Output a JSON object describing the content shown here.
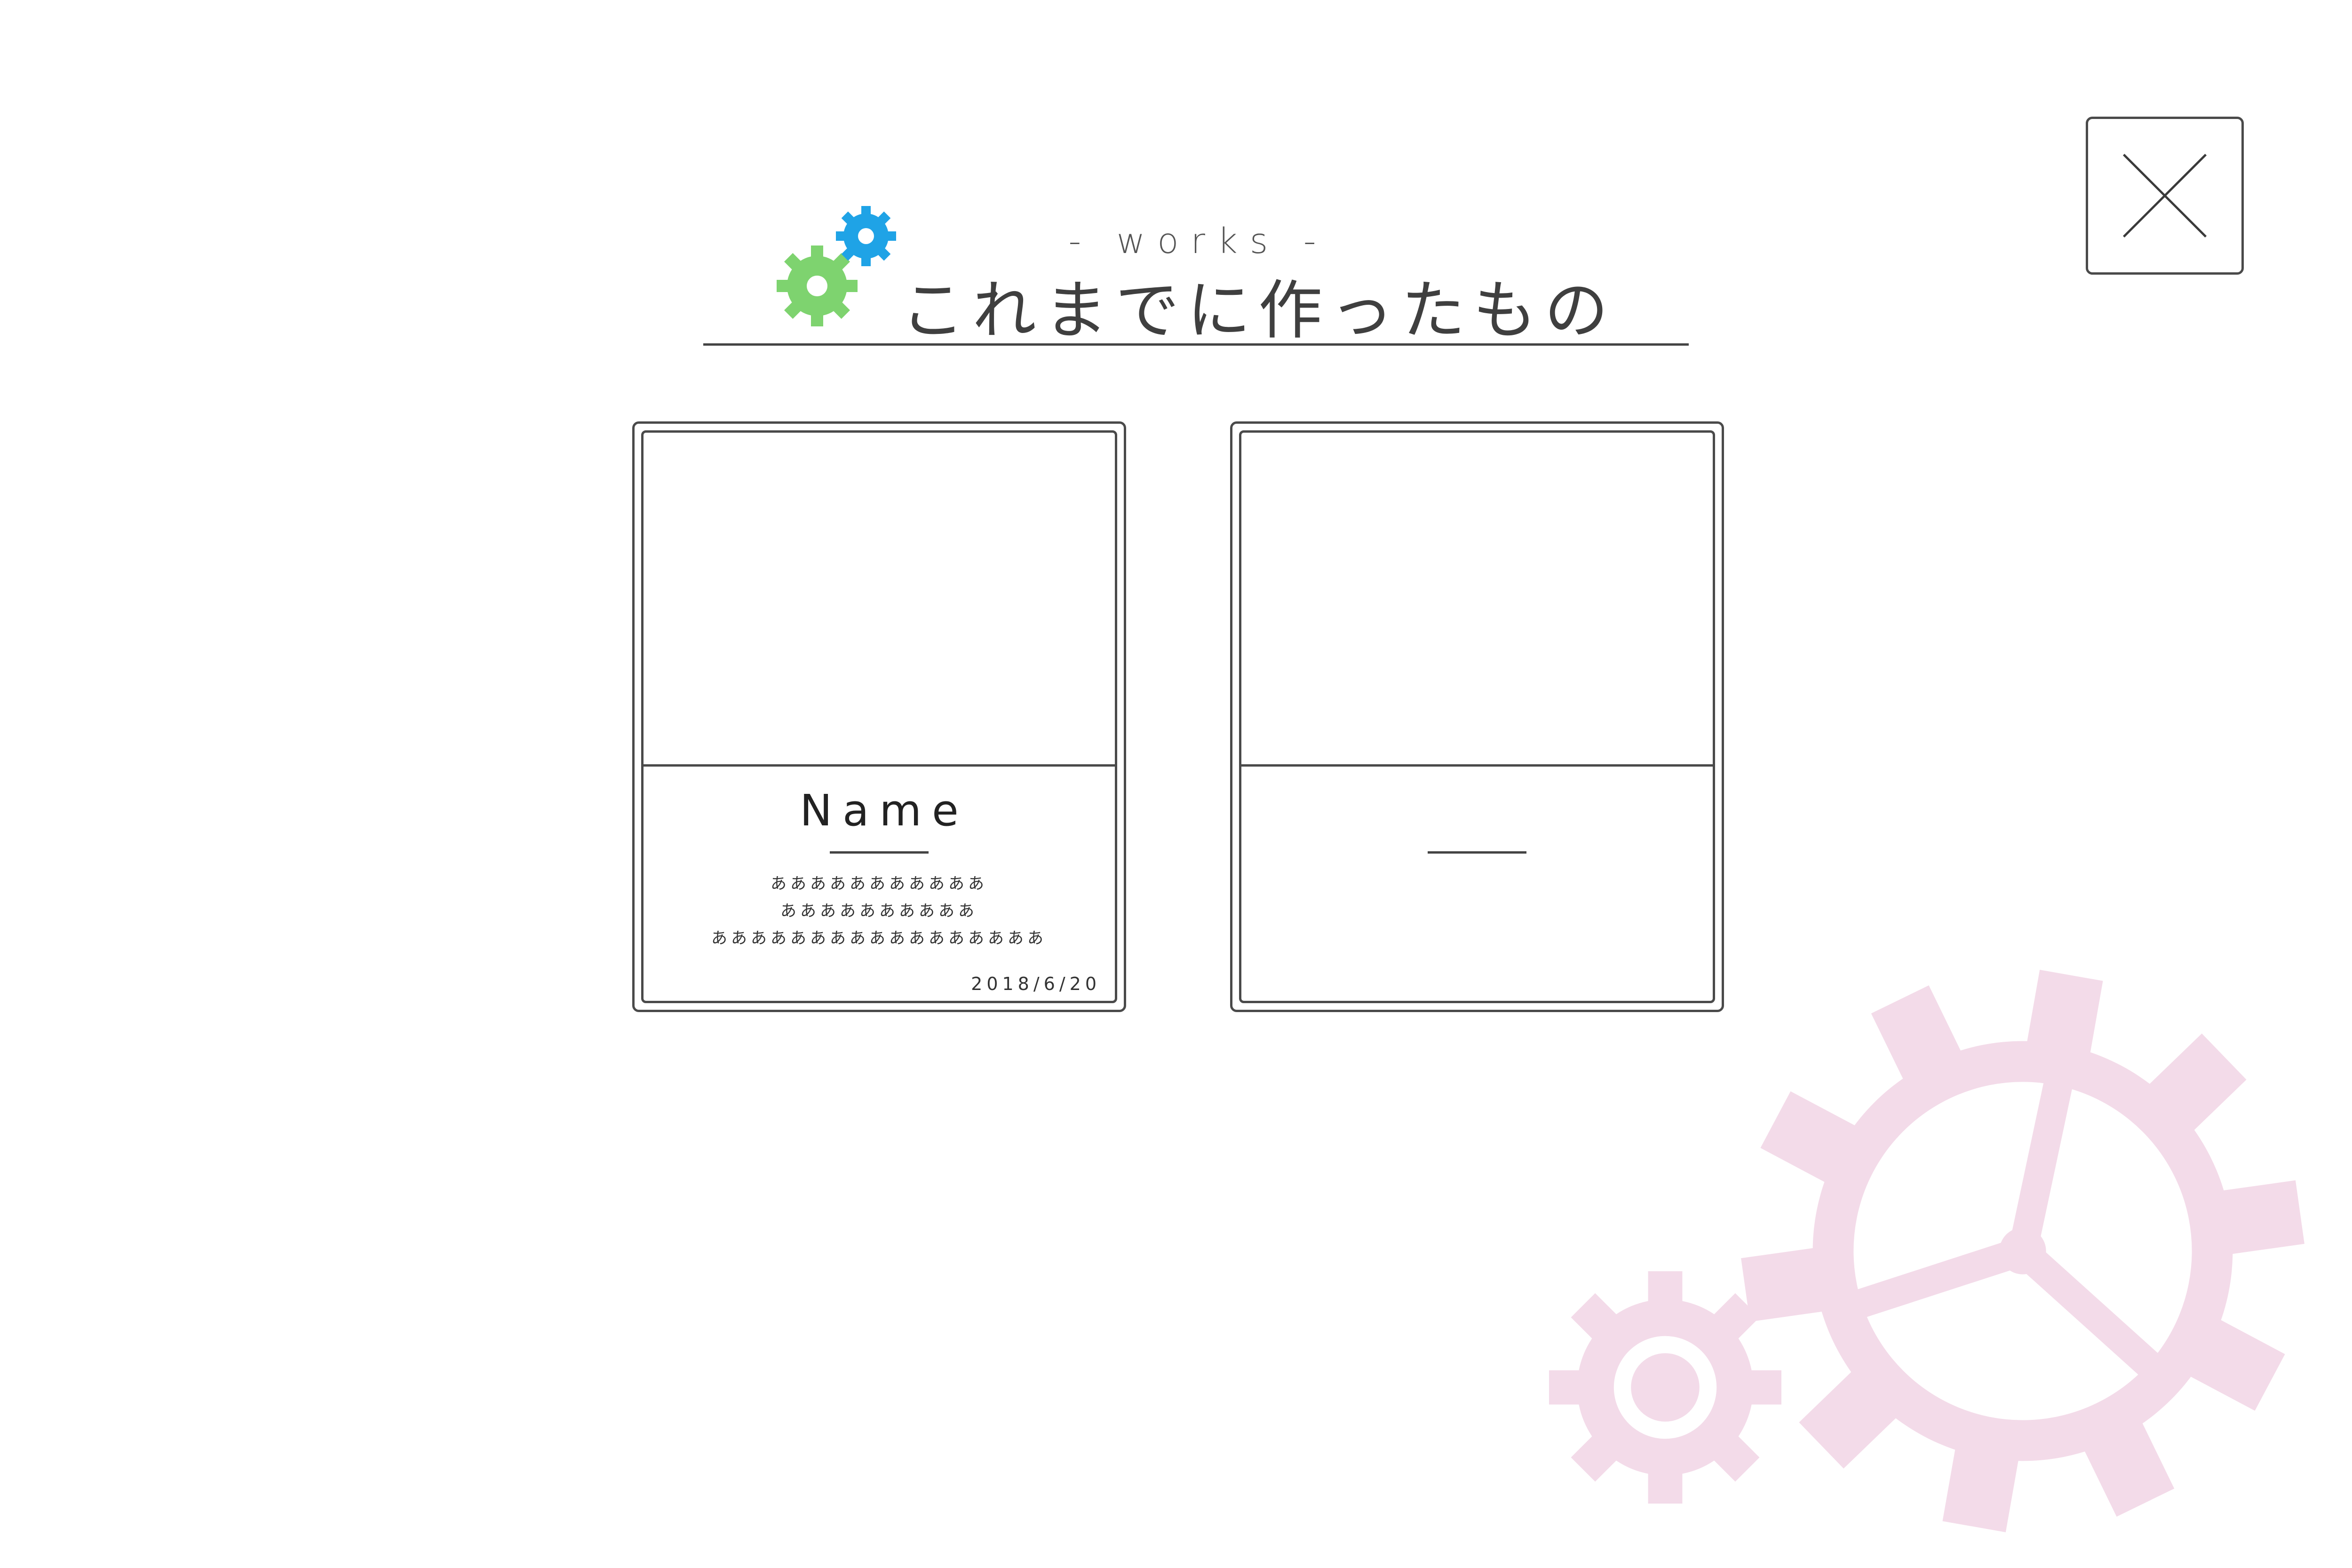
{
  "header": {
    "subtitle": "- works -",
    "title": "これまでに作ったもの"
  },
  "icons": {
    "logo": [
      "gear-icon-green",
      "gear-icon-blue"
    ],
    "close": "close-icon",
    "background": [
      "gear-icon-pink-large",
      "gear-icon-pink-small"
    ]
  },
  "colors": {
    "gear_green": "#7ed36f",
    "gear_blue": "#1fa3e6",
    "gear_pink": "#f3dbe9",
    "line": "#4a4a4a",
    "text": "#3f3f3f"
  },
  "works": [
    {
      "name": "Name",
      "description": [
        "あああああああああああ",
        "ああああああああああ",
        "あああああああああああああああああ"
      ],
      "date": "2018/6/20"
    },
    {
      "name": "",
      "description": [],
      "date": ""
    }
  ]
}
